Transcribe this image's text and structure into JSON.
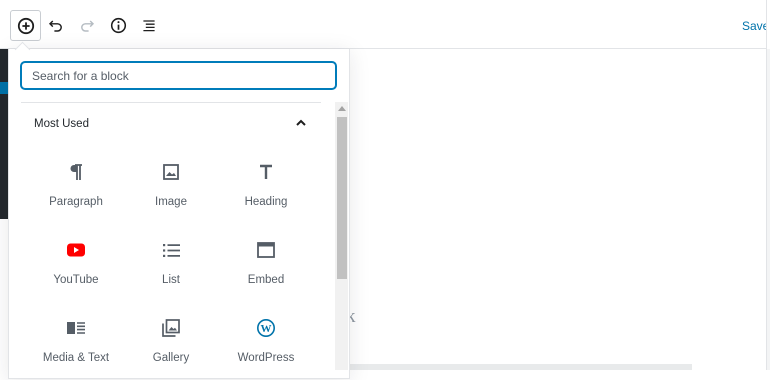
{
  "toolbar": {
    "add_icon": "plus-circle-icon",
    "undo_icon": "undo-icon",
    "redo_icon": "redo-icon",
    "info_icon": "info-icon",
    "navigation_icon": "list-icon",
    "save_label": "Save I"
  },
  "inserter": {
    "search_placeholder": "Search for a block",
    "panel_title": "Most Used",
    "blocks": [
      {
        "label": "Paragraph",
        "icon": "paragraph-icon"
      },
      {
        "label": "Image",
        "icon": "image-icon"
      },
      {
        "label": "Heading",
        "icon": "heading-icon"
      },
      {
        "label": "YouTube",
        "icon": "youtube-icon"
      },
      {
        "label": "List",
        "icon": "list-icon"
      },
      {
        "label": "Embed",
        "icon": "embed-icon"
      },
      {
        "label": "Media & Text",
        "icon": "media-text-icon"
      },
      {
        "label": "Gallery",
        "icon": "gallery-icon"
      },
      {
        "label": "WordPress",
        "icon": "wordpress-icon"
      }
    ]
  },
  "canvas": {
    "partial_text": "k"
  },
  "colors": {
    "accent": "#007cba",
    "youtube_red": "#ff0000",
    "wordpress_blue": "#0073aa"
  }
}
